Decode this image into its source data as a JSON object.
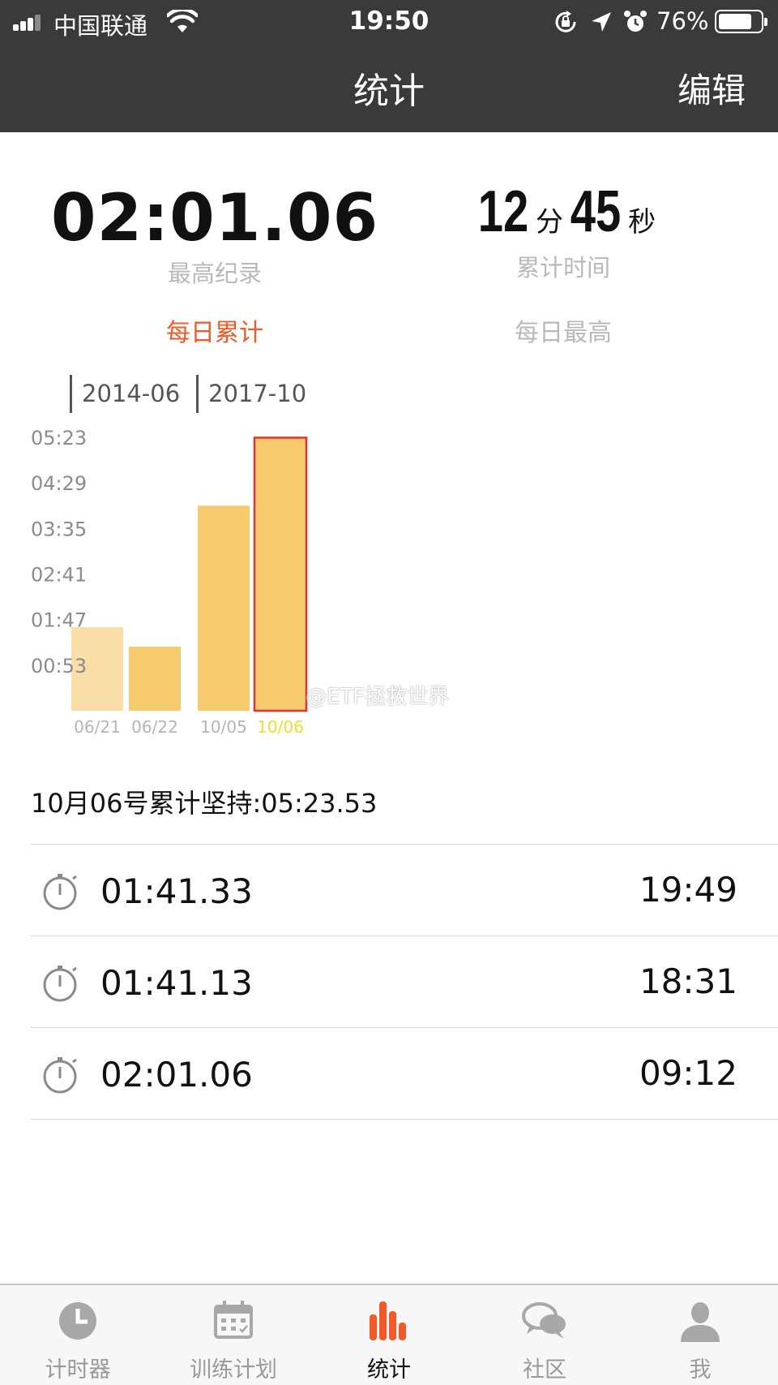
{
  "status_bar": {
    "carrier": "中国联通",
    "time": "19:50",
    "battery_percent": "76%",
    "battery_level": 0.76,
    "icons": [
      "signal-icon",
      "wifi-icon",
      "orientation-lock-icon",
      "location-arrow-icon",
      "alarm-icon",
      "battery-icon"
    ]
  },
  "nav": {
    "title": "统计",
    "edit_label": "编辑"
  },
  "summary": {
    "best_value": "02:01.06",
    "best_label": "最高纪录",
    "total_minutes": "12",
    "total_minutes_unit": "分",
    "total_seconds": "45",
    "total_seconds_unit": "秒",
    "total_label": "累计时间"
  },
  "tabs": {
    "daily_total": "每日累计",
    "daily_best": "每日最高",
    "active_color": "#f05a28"
  },
  "periods": [
    "2014-06",
    "2017-10"
  ],
  "chart_data": {
    "type": "bar",
    "categories": [
      "06/21",
      "06/22",
      "10/05",
      "10/06"
    ],
    "values_seconds": [
      99,
      76,
      243,
      323.53
    ],
    "ytick_labels": [
      "05:23",
      "04:29",
      "03:35",
      "02:41",
      "01:47",
      "00:53"
    ],
    "ytick_values_seconds": [
      323,
      269,
      215,
      161,
      107,
      53
    ],
    "ylim_seconds": [
      0,
      323
    ],
    "selected_index": 3,
    "bar_color": "#f7cb6d",
    "bar_color_faded": "#f9dea8",
    "selected_outline_color": "#e83030",
    "selected_label_color": "#f2dc2c",
    "xlabel": "",
    "ylabel": ""
  },
  "watermark": "@ETF拯救世界",
  "day_summary": "10月06号累计坚持:05:23.53",
  "records": [
    {
      "duration": "01:41.33",
      "time": "19:49"
    },
    {
      "duration": "01:41.13",
      "time": "18:31"
    },
    {
      "duration": "02:01.06",
      "time": "09:12"
    }
  ],
  "tabbar": {
    "items": [
      {
        "label": "计时器",
        "icon": "clock-icon"
      },
      {
        "label": "训练计划",
        "icon": "calendar-icon"
      },
      {
        "label": "统计",
        "icon": "bar-chart-icon"
      },
      {
        "label": "社区",
        "icon": "chat-bubbles-icon"
      },
      {
        "label": "我",
        "icon": "person-icon"
      }
    ],
    "active_index": 2,
    "active_color": "#f05a28",
    "inactive_color": "#a8a8a8"
  }
}
